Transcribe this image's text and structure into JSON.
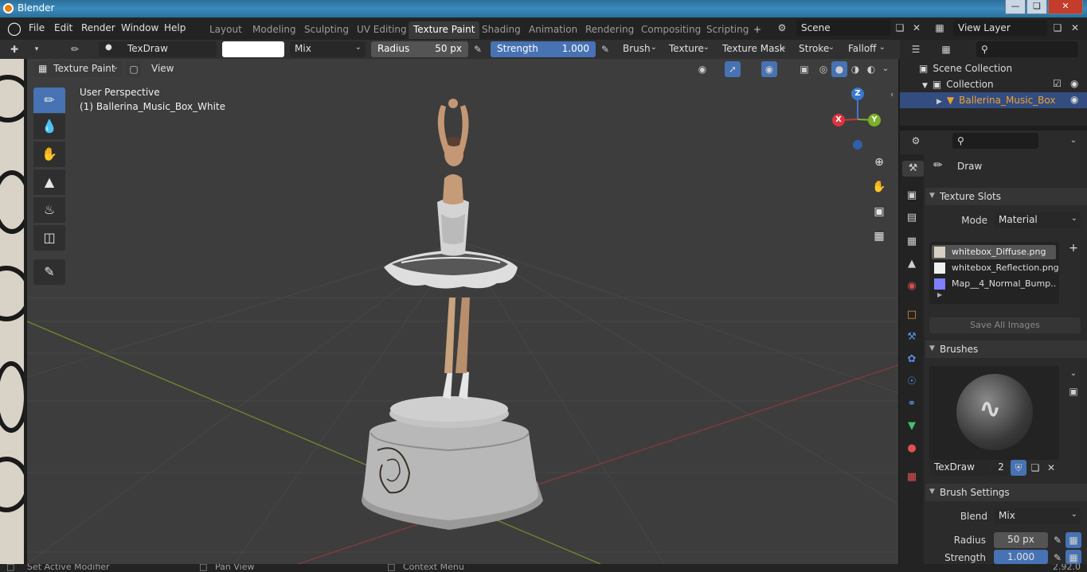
{
  "window": {
    "title": "Blender"
  },
  "menu": {
    "items": [
      "File",
      "Edit",
      "Render",
      "Window",
      "Help"
    ]
  },
  "workspaces": {
    "tabs": [
      "Layout",
      "Modeling",
      "Sculpting",
      "UV Editing",
      "Texture Paint",
      "Shading",
      "Animation",
      "Rendering",
      "Compositing",
      "Scripting"
    ],
    "active": "Texture Paint",
    "add": "+"
  },
  "scene": {
    "name": "Scene"
  },
  "view_layer": {
    "name": "View Layer"
  },
  "tool_header": {
    "brush_name": "TexDraw",
    "blend": "Mix",
    "radius_label": "Radius",
    "radius_value": "50 px",
    "strength_label": "Strength",
    "strength_value": "1.000",
    "strength_fraction": 1.0,
    "menus": [
      "Brush",
      "Texture",
      "Texture Mask",
      "Stroke",
      "Falloff"
    ],
    "color": "#ffffff"
  },
  "viewport": {
    "mode": "Texture Paint",
    "view_menu": "View",
    "perspective": "User Perspective",
    "object": "(1) Ballerina_Music_Box_White",
    "gizmo": {
      "z": "Z",
      "x": "X",
      "y": "Y"
    }
  },
  "outliner": {
    "scene_collection": "Scene Collection",
    "collection": "Collection",
    "object": "Ballerina_Music_Box"
  },
  "properties": {
    "tool": "Draw",
    "texture_slots": {
      "header": "Texture Slots",
      "mode_label": "Mode",
      "mode_value": "Material",
      "slots": [
        "whitebox_Diffuse.png",
        "whitebox_Reflection.png",
        "Map__4_Normal_Bump...."
      ],
      "save_all": "Save All Images"
    },
    "brushes": {
      "header": "Brushes",
      "brush_name": "TexDraw",
      "users": "2"
    },
    "brush_settings": {
      "header": "Brush Settings",
      "blend_label": "Blend",
      "blend_value": "Mix",
      "radius_label": "Radius",
      "radius_value": "50 px",
      "strength_label": "Strength",
      "strength_value": "1.000"
    }
  },
  "statusbar": {
    "left": "Set Active Modifier",
    "middle": "Pan View",
    "right": "Context Menu",
    "version": "2.92.0"
  },
  "colors": {
    "accent": "#4772b3",
    "selected_object": "#f0a030",
    "viewport_bg": "#3d3d3d"
  }
}
